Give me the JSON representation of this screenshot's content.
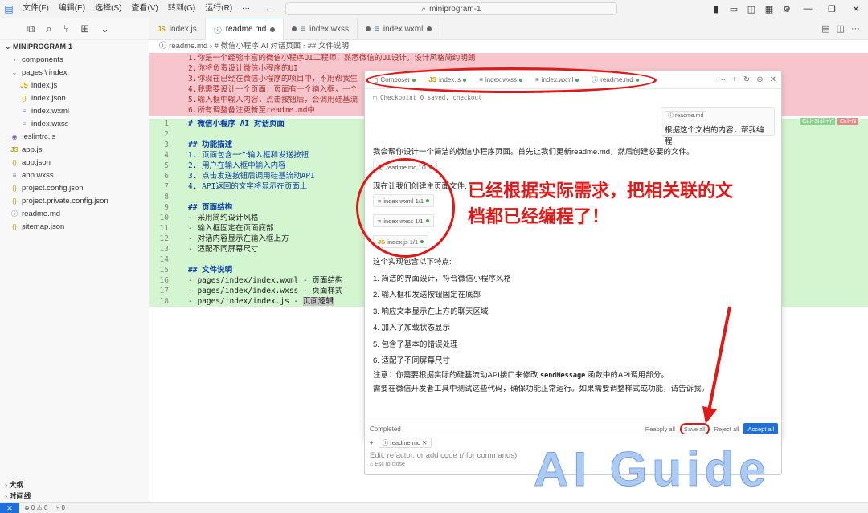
{
  "titlebar": {
    "menu": [
      "文件(F)",
      "编辑(E)",
      "选择(S)",
      "查看(V)",
      "转到(G)",
      "运行(R)",
      "···"
    ],
    "search": "miniprogram-1"
  },
  "explorer": {
    "title": "MINIPROGRAM-1",
    "items": [
      {
        "icon": "›",
        "label": "components",
        "indent": 1
      },
      {
        "icon": "⌄",
        "label": "pages \\ index",
        "indent": 1
      },
      {
        "icon": "JS",
        "label": "index.js",
        "indent": 2
      },
      {
        "icon": "{}",
        "label": "index.json",
        "indent": 2
      },
      {
        "icon": "≡",
        "label": "index.wxml",
        "indent": 2
      },
      {
        "icon": "≡",
        "label": "index.wxss",
        "indent": 2
      },
      {
        "icon": "◉",
        "label": ".eslintrc.js",
        "indent": 1
      },
      {
        "icon": "JS",
        "label": "app.js",
        "indent": 1
      },
      {
        "icon": "{}",
        "label": "app.json",
        "indent": 1
      },
      {
        "icon": "≡",
        "label": "app.wxss",
        "indent": 1
      },
      {
        "icon": "{}",
        "label": "project.config.json",
        "indent": 1
      },
      {
        "icon": "{}",
        "label": "project.private.config.json",
        "indent": 1
      },
      {
        "icon": "ⓘ",
        "label": "readme.md",
        "indent": 1
      },
      {
        "icon": "{}",
        "label": "sitemap.json",
        "indent": 1
      }
    ],
    "outline": "大纲",
    "timeline": "时间线"
  },
  "tabs": [
    {
      "icon": "JS",
      "label": "index.js"
    },
    {
      "icon": "ⓘ",
      "label": "readme.md"
    },
    {
      "icon": "≡",
      "label": "index.wxss"
    },
    {
      "icon": "≡",
      "label": "index.wxml"
    }
  ],
  "breadcrumb": "ⓘ readme.md  ›  # 微信小程序 AI 对话页面  ›  ## 文件说明",
  "removed_lines": [
    "1.你是一个经验丰富的微信小程序UI工程师，熟悉微信的UI设计，设计风格简约明朗",
    "2.你将负责设计微信小程序的UI",
    "3.你现在已经在微信小程序的项目中，不用帮我生",
    "4.我需要设计一个页面：页面有一个输入框，一个",
    "5.输入框中输入内容，点击按钮后，会调用硅基流",
    "6.所有调整备注更新至readme.md中"
  ],
  "code_lines": [
    {
      "n": "1",
      "text": "# 微信小程序 AI 对话页面",
      "kind": "head"
    },
    {
      "n": "2",
      "text": "",
      "kind": "plain"
    },
    {
      "n": "3",
      "text": "## 功能描述",
      "kind": "head"
    },
    {
      "n": "4",
      "text": "1. 页面包含一个输入框和发送按钮",
      "kind": "list"
    },
    {
      "n": "5",
      "text": "2. 用户在输入框中输入内容",
      "kind": "list"
    },
    {
      "n": "6",
      "text": "3. 点击发送按钮后调用硅基流动API",
      "kind": "list"
    },
    {
      "n": "7",
      "text": "4. API返回的文字将显示在页面上",
      "kind": "list"
    },
    {
      "n": "8",
      "text": "",
      "kind": "plain"
    },
    {
      "n": "9",
      "text": "## 页面结构",
      "kind": "head"
    },
    {
      "n": "10",
      "text": "- 采用简约设计风格",
      "kind": "plain"
    },
    {
      "n": "11",
      "text": "- 输入框固定在页面底部",
      "kind": "plain"
    },
    {
      "n": "12",
      "text": "- 对话内容显示在输入框上方",
      "kind": "plain"
    },
    {
      "n": "13",
      "text": "- 适配不同屏幕尺寸",
      "kind": "plain"
    },
    {
      "n": "14",
      "text": "",
      "kind": "plain"
    },
    {
      "n": "15",
      "text": "## 文件说明",
      "kind": "head"
    },
    {
      "n": "16",
      "text": "- pages/index/index.wxml - 页面结构",
      "kind": "plain"
    },
    {
      "n": "17",
      "text": "- pages/index/index.wxss - 页面样式",
      "kind": "plain"
    },
    {
      "n": "18",
      "text": "- pages/index/index.js - ",
      "kind": "plain",
      "sel": "页面逻辑"
    }
  ],
  "kbd_hints": [
    "Ctrl+Shift+Y",
    "Ctrl+N"
  ],
  "composer": {
    "tabs": [
      "Composer",
      "index.js",
      "index.wxss",
      "index.wxml",
      "readme.md"
    ],
    "checkpoint": "Checkpoint 0 saved. checkout",
    "user_chip": "readme.md",
    "user_text": "根据这个文档的内容，帮我编程",
    "reply1": "我会帮你设计一个简洁的微信小程序页面。首先让我们更新readme.md，然后创建必要的文件。",
    "chip_readme": "readme.md  1/1",
    "reply2": "现在让我们创建主页面文件:",
    "chip_wxml": "index.wxml  1/1",
    "chip_wxss": "index.wxss  1/1",
    "chip_js": "index.js  1/1",
    "features_intro": "这个实现包含以下特点:",
    "features": [
      "1. 简洁的界面设计，符合微信小程序风格",
      "2. 输入框和发送按钮固定在底部",
      "3. 响应文本显示在上方的聊天区域",
      "4. 加入了加载状态显示",
      "5. 包含了基本的错误处理",
      "6. 适配了不同屏幕尺寸"
    ],
    "note_prefix": "注意：你需要根据实际的硅基流动API接口来修改 ",
    "note_code": "sendMessage",
    "note_suffix": " 函数中的API调用部分。",
    "note2": "需要在微信开发者工具中测试这些代码，确保功能正常运行。如果需要调整样式或功能，请告诉我。",
    "status": "Completed",
    "reapply": "Reapply all",
    "save_all": "Save all",
    "reject_all": "Reject all",
    "accept_all": "Accept all"
  },
  "input": {
    "chip": "readme.md",
    "placeholder": "Edit, refactor, or add code (/ for commands)",
    "hint": "Esc to close"
  },
  "annotation": {
    "line1": "已经根据实际需求，把相关联的文",
    "line2": "档都已经编程了！"
  },
  "watermark": "AI Guide",
  "statusbar": {
    "errors": "⊗ 0 ⚠ 0",
    "ports": "⑂ 0"
  },
  "colors": {
    "accent": "#1e6fd9",
    "annotation": "#e01818",
    "removed_bg": "#f7c6cc",
    "added_bg": "#d3f5cf"
  }
}
